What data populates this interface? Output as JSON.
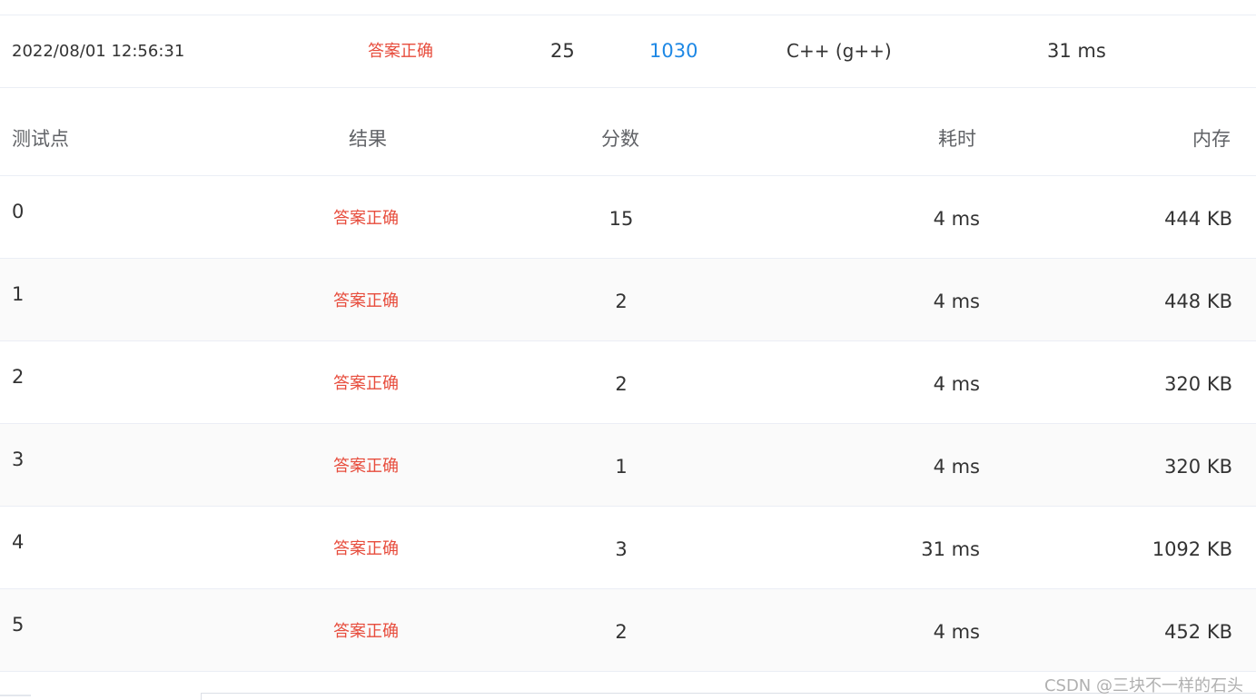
{
  "colors": {
    "accepted": "#e74c3c",
    "link": "#1e88e5",
    "header_text": "#606266",
    "body_text": "#333333",
    "border": "#ebeef5"
  },
  "submission": {
    "time": "2022/08/01 12:56:31",
    "status": "答案正确",
    "score": "25",
    "problem": "1030",
    "compiler": "C++ (g++)",
    "time_used": "31 ms"
  },
  "table": {
    "headers": {
      "case": "测试点",
      "result": "结果",
      "score": "分数",
      "time": "耗时",
      "memory": "内存"
    },
    "rows": [
      {
        "id": "0",
        "result": "答案正确",
        "score": "15",
        "time": "4 ms",
        "memory": "444 KB"
      },
      {
        "id": "1",
        "result": "答案正确",
        "score": "2",
        "time": "4 ms",
        "memory": "448 KB"
      },
      {
        "id": "2",
        "result": "答案正确",
        "score": "2",
        "time": "4 ms",
        "memory": "320 KB"
      },
      {
        "id": "3",
        "result": "答案正确",
        "score": "1",
        "time": "4 ms",
        "memory": "320 KB"
      },
      {
        "id": "4",
        "result": "答案正确",
        "score": "3",
        "time": "31 ms",
        "memory": "1092 KB"
      },
      {
        "id": "5",
        "result": "答案正确",
        "score": "2",
        "time": "4 ms",
        "memory": "452 KB"
      }
    ]
  },
  "watermark": "CSDN @三块不一样的石头"
}
